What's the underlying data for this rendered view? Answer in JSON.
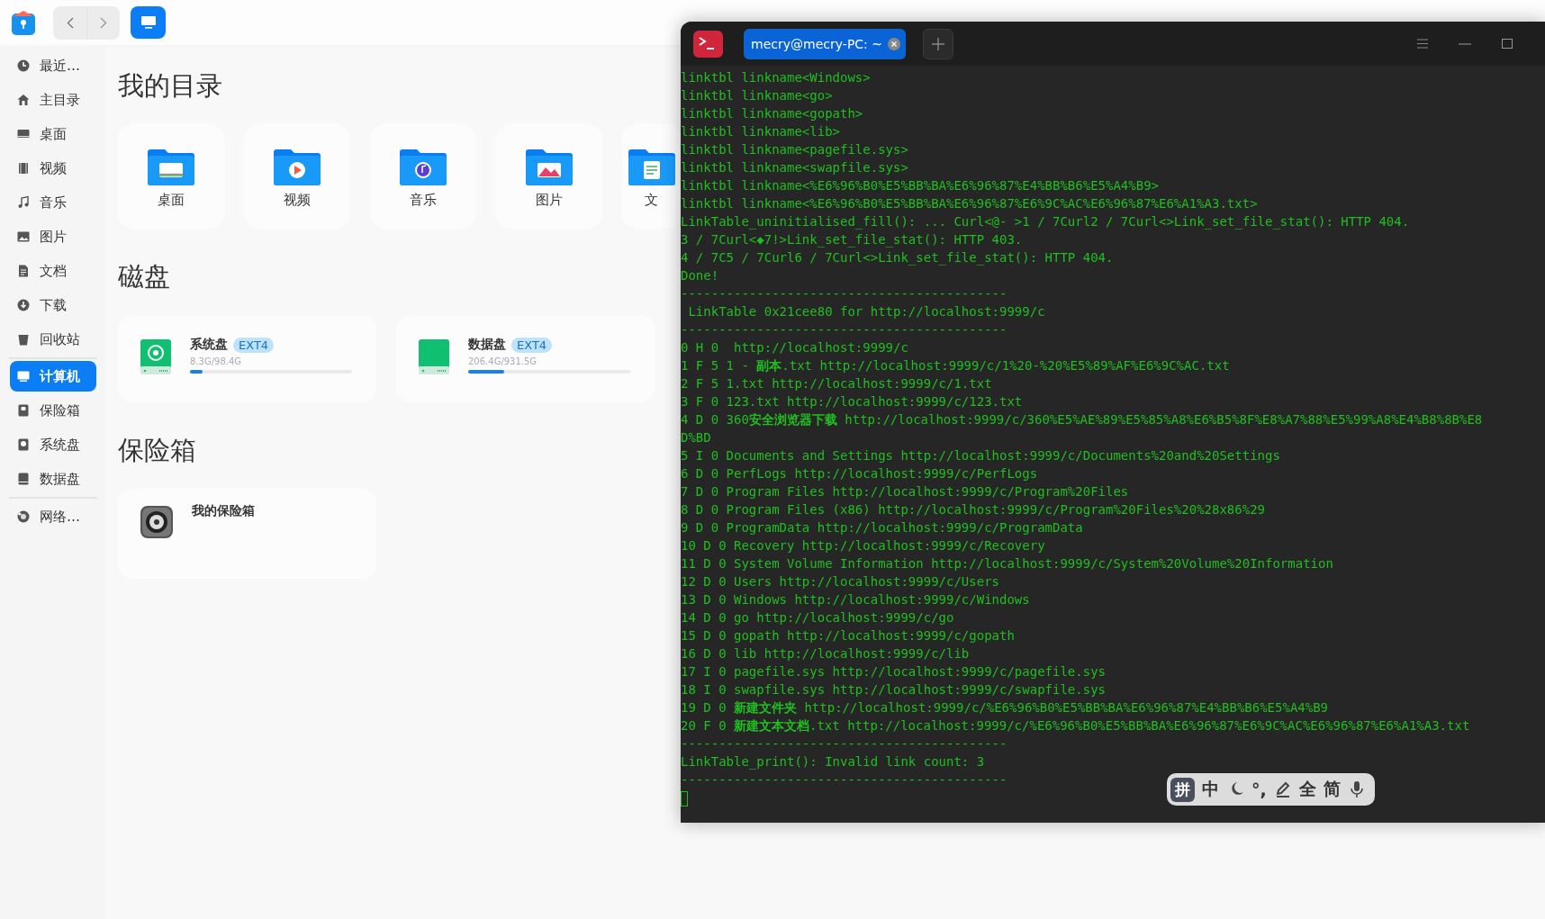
{
  "file_manager": {
    "sidebar": {
      "groups": [
        {
          "items": [
            {
              "label": "最近…",
              "selected": false
            },
            {
              "label": "主目录",
              "selected": false
            },
            {
              "label": "桌面",
              "selected": false
            },
            {
              "label": "视频",
              "selected": false
            },
            {
              "label": "音乐",
              "selected": false
            },
            {
              "label": "图片",
              "selected": false
            },
            {
              "label": "文档",
              "selected": false
            },
            {
              "label": "下载",
              "selected": false
            },
            {
              "label": "回收站",
              "selected": false
            }
          ]
        },
        {
          "items": [
            {
              "label": "计算机",
              "selected": true
            },
            {
              "label": "保险箱",
              "selected": false
            },
            {
              "label": "系统盘",
              "selected": false
            },
            {
              "label": "数据盘",
              "selected": false
            }
          ]
        },
        {
          "items": [
            {
              "label": "网络…",
              "selected": false
            }
          ]
        }
      ]
    },
    "sections": [
      {
        "kind": "folders",
        "title": "我的目录",
        "items": [
          {
            "label": "桌面"
          },
          {
            "label": "视频"
          },
          {
            "label": "音乐"
          },
          {
            "label": "图片"
          },
          {
            "label": "文"
          }
        ]
      },
      {
        "kind": "disks",
        "title": "磁盘",
        "items": [
          {
            "name": "系统盘",
            "fs": "EXT4",
            "usage": "8.3G/98.4G",
            "level": 0.08
          },
          {
            "name": "数据盘",
            "fs": "EXT4",
            "usage": "206.4G/931.5G",
            "level": 0.22
          }
        ]
      },
      {
        "kind": "vaults",
        "title": "保险箱",
        "items": [
          {
            "name": "我的保险箱"
          }
        ]
      }
    ]
  },
  "terminal": {
    "tabs": [
      {
        "title": "mecry@mecry-PC: ~",
        "selected": true
      }
    ],
    "lines": [
      "linktbl linkname<Windows>",
      "linktbl linkname<go>",
      "linktbl linkname<gopath>",
      "linktbl linkname<lib>",
      "linktbl linkname<pagefile.sys>",
      "linktbl linkname<swapfile.sys>",
      "linktbl linkname<%E6%96%B0%E5%BB%BA%E6%96%87%E4%BB%B6%E5%A4%B9>",
      "linktbl linkname<%E6%96%B0%E5%BB%BA%E6%96%87%E6%9C%AC%E6%96%87%E6%A1%A3.txt>",
      "LinkTable_uninitialised_fill(): ... Curl<@- >1 / 7Curl2 / 7Curl<>Link_set_file_stat(): HTTP 404.",
      "3 / 7Curl<◆7!>Link_set_file_stat(): HTTP 403.",
      "4 / 7C5 / 7Curl6 / 7Curl<>Link_set_file_stat(): HTTP 404.",
      "Done!",
      "-------------------------------------------",
      " LinkTable 0x21cee80 for http://localhost:9999/c",
      "-------------------------------------------",
      "0 H 0  http://localhost:9999/c",
      "1 F 5 1 - **副本**.txt http://localhost:9999/c/1%20-%20%E5%89%AF%E6%9C%AC.txt",
      "2 F 5 1.txt http://localhost:9999/c/1.txt",
      "3 F 0 123.txt http://localhost:9999/c/123.txt",
      "4 D 0 360**安全浏览器下载** http://localhost:9999/c/360%E5%AE%89%E5%85%A8%E6%B5%8F%E8%A7%88%E5%99%A8%E4%B8%8B%E8",
      "D%BD",
      "5 I 0 Documents and Settings http://localhost:9999/c/Documents%20and%20Settings",
      "6 D 0 PerfLogs http://localhost:9999/c/PerfLogs",
      "7 D 0 Program Files http://localhost:9999/c/Program%20Files",
      "8 D 0 Program Files (x86) http://localhost:9999/c/Program%20Files%20%28x86%29",
      "9 D 0 ProgramData http://localhost:9999/c/ProgramData",
      "10 D 0 Recovery http://localhost:9999/c/Recovery",
      "11 D 0 System Volume Information http://localhost:9999/c/System%20Volume%20Information",
      "12 D 0 Users http://localhost:9999/c/Users",
      "13 D 0 Windows http://localhost:9999/c/Windows",
      "14 D 0 go http://localhost:9999/c/go",
      "15 D 0 gopath http://localhost:9999/c/gopath",
      "16 D 0 lib http://localhost:9999/c/lib",
      "17 I 0 pagefile.sys http://localhost:9999/c/pagefile.sys",
      "18 I 0 swapfile.sys http://localhost:9999/c/swapfile.sys",
      "19 D 0 **新建文件夹** http://localhost:9999/c/%E6%96%B0%E5%BB%BA%E6%96%87%E4%BB%B6%E5%A4%B9",
      "20 F 0 **新建文本文档**.txt http://localhost:9999/c/%E6%96%B0%E5%BB%BA%E6%96%87%E6%9C%AC%E6%96%87%E6%A1%A3.txt",
      "-------------------------------------------",
      "LinkTable_print(): Invalid link count: 3",
      "-------------------------------------------"
    ]
  },
  "input_method": {
    "items": [
      {
        "kind": "badge",
        "text": "拼"
      },
      {
        "kind": "text",
        "text": "中"
      },
      {
        "kind": "icon"
      },
      {
        "kind": "text",
        "text": "°,"
      },
      {
        "kind": "icon"
      },
      {
        "kind": "text",
        "text": "全"
      },
      {
        "kind": "text",
        "text": "简"
      },
      {
        "kind": "icon"
      }
    ]
  }
}
